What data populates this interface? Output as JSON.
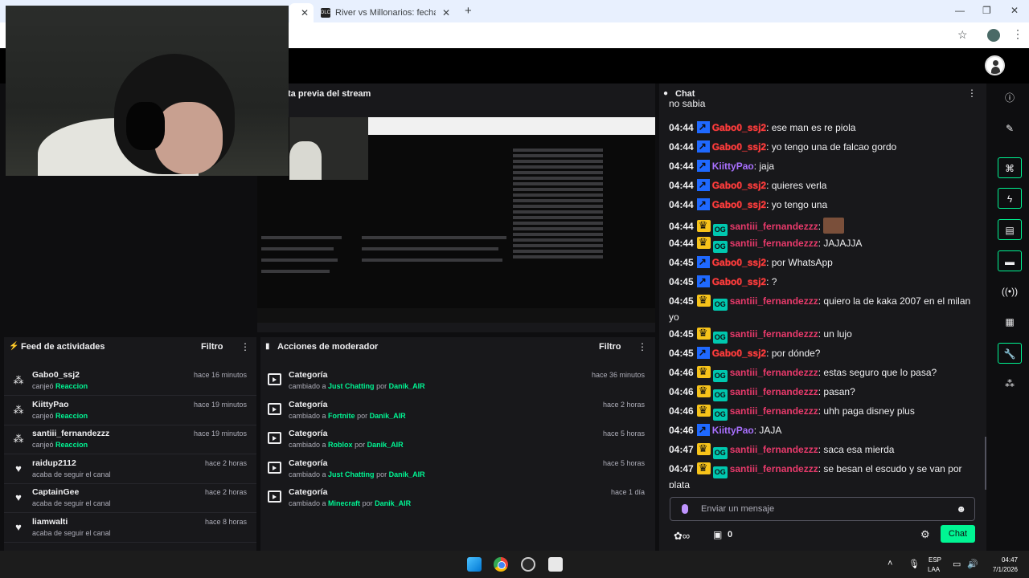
{
  "browser": {
    "tab_title": "River vs Millonarios: fecha, hora",
    "tab_favicon": "DLC"
  },
  "preview": {
    "title": "ta previa del stream"
  },
  "activity": {
    "title": "Feed de actividades",
    "filter": "Filtro",
    "items": [
      {
        "user": "Gabo0_ssj2",
        "prefix": "canjeó",
        "highlight": "Reaccion",
        "time": "hace 16 minutos",
        "icon": "reward-icon"
      },
      {
        "user": "KiittyPao",
        "prefix": "canjeó",
        "highlight": "Reaccion",
        "time": "hace 19 minutos",
        "icon": "reward-icon"
      },
      {
        "user": "santiii_fernandezzz",
        "prefix": "canjeó",
        "highlight": "Reaccion",
        "time": "hace 19 minutos",
        "icon": "reward-icon"
      },
      {
        "user": "raidup2112",
        "prefix": "acaba de seguir el canal",
        "highlight": "",
        "time": "hace 2 horas",
        "icon": "heart-icon"
      },
      {
        "user": "CaptainGee",
        "prefix": "acaba de seguir el canal",
        "highlight": "",
        "time": "hace 2 horas",
        "icon": "heart-icon"
      },
      {
        "user": "liamwalti",
        "prefix": "acaba de seguir el canal",
        "highlight": "",
        "time": "hace 8 horas",
        "icon": "heart-icon"
      }
    ]
  },
  "mod": {
    "title": "Acciones de moderador",
    "filter": "Filtro",
    "items": [
      {
        "title": "Categoría",
        "prefix": "cambiado a",
        "category": "Just Chatting",
        "by": "por",
        "user": "Danik_AIR",
        "time": "hace 36 minutos"
      },
      {
        "title": "Categoría",
        "prefix": "cambiado a",
        "category": "Fortnite",
        "by": "por",
        "user": "Danik_AIR",
        "time": "hace 2 horas"
      },
      {
        "title": "Categoría",
        "prefix": "cambiado a",
        "category": "Roblox",
        "by": "por",
        "user": "Danik_AIR",
        "time": "hace 5 horas"
      },
      {
        "title": "Categoría",
        "prefix": "cambiado a",
        "category": "Just Chatting",
        "by": "por",
        "user": "Danik_AIR",
        "time": "hace 5 horas"
      },
      {
        "title": "Categoría",
        "prefix": "cambiado a",
        "category": "Minecraft",
        "by": "por",
        "user": "Danik_AIR",
        "time": "hace 1 día"
      }
    ]
  },
  "chat": {
    "title": "Chat",
    "partial_top": "no sabia",
    "messages": [
      {
        "time": "04:44",
        "badges": [
          "prime"
        ],
        "user": "Gabo0_ssj2",
        "color": "red",
        "text": "ese man es re piola"
      },
      {
        "time": "04:44",
        "badges": [
          "prime"
        ],
        "user": "Gabo0_ssj2",
        "color": "red",
        "text": "yo tengo una de falcao gordo"
      },
      {
        "time": "04:44",
        "badges": [
          "prime"
        ],
        "user": "KiittyPao",
        "color": "purple",
        "text": "jaja"
      },
      {
        "time": "04:44",
        "badges": [
          "prime"
        ],
        "user": "Gabo0_ssj2",
        "color": "red",
        "text": "quieres verla"
      },
      {
        "time": "04:44",
        "badges": [
          "prime"
        ],
        "user": "Gabo0_ssj2",
        "color": "red",
        "text": "yo tengo una"
      },
      {
        "time": "04:44",
        "badges": [
          "crown",
          "og"
        ],
        "user": "santiii_fernandezzz",
        "color": "pink",
        "text": "",
        "emote": true
      },
      {
        "time": "04:44",
        "badges": [
          "crown",
          "og"
        ],
        "user": "santiii_fernandezzz",
        "color": "pink",
        "text": "JAJAJJA"
      },
      {
        "time": "04:45",
        "badges": [
          "prime"
        ],
        "user": "Gabo0_ssj2",
        "color": "red",
        "text": "por WhatsApp"
      },
      {
        "time": "04:45",
        "badges": [
          "prime"
        ],
        "user": "Gabo0_ssj2",
        "color": "red",
        "text": "?"
      },
      {
        "time": "04:45",
        "badges": [
          "crown",
          "og"
        ],
        "user": "santiii_fernandezzz",
        "color": "pink",
        "text": "quiero la de kaka 2007 en el milan yo"
      },
      {
        "time": "04:45",
        "badges": [
          "crown",
          "og"
        ],
        "user": "santiii_fernandezzz",
        "color": "pink",
        "text": "un lujo"
      },
      {
        "time": "04:45",
        "badges": [
          "prime"
        ],
        "user": "Gabo0_ssj2",
        "color": "red",
        "text": "por dónde?"
      },
      {
        "time": "04:46",
        "badges": [
          "crown",
          "og"
        ],
        "user": "santiii_fernandezzz",
        "color": "pink",
        "text": "estas seguro que lo pasa?"
      },
      {
        "time": "04:46",
        "badges": [
          "crown",
          "og"
        ],
        "user": "santiii_fernandezzz",
        "color": "pink",
        "text": "pasan?"
      },
      {
        "time": "04:46",
        "badges": [
          "crown",
          "og"
        ],
        "user": "santiii_fernandezzz",
        "color": "pink",
        "text": "uhh paga disney plus"
      },
      {
        "time": "04:46",
        "badges": [
          "prime"
        ],
        "user": "KiittyPao",
        "color": "purple",
        "text": "JAJA"
      },
      {
        "time": "04:47",
        "badges": [
          "crown",
          "og"
        ],
        "user": "santiii_fernandezzz",
        "color": "pink",
        "text": "saca esa mierda"
      },
      {
        "time": "04:47",
        "badges": [
          "crown",
          "og"
        ],
        "user": "santiii_fernandezzz",
        "color": "pink",
        "text": "se besan el escudo y se van por plata"
      }
    ],
    "input_placeholder": "Enviar un mensaje",
    "points": "0",
    "send_label": "Chat"
  },
  "taskbar": {
    "lang1": "ESP",
    "lang2": "LAA",
    "time": "04:47",
    "date": "7/1/2026"
  },
  "colors": {
    "accent": "#00f593",
    "red_user": "#ff3c3c",
    "pink_user": "#e83a6b",
    "purple_user": "#a970ff"
  }
}
